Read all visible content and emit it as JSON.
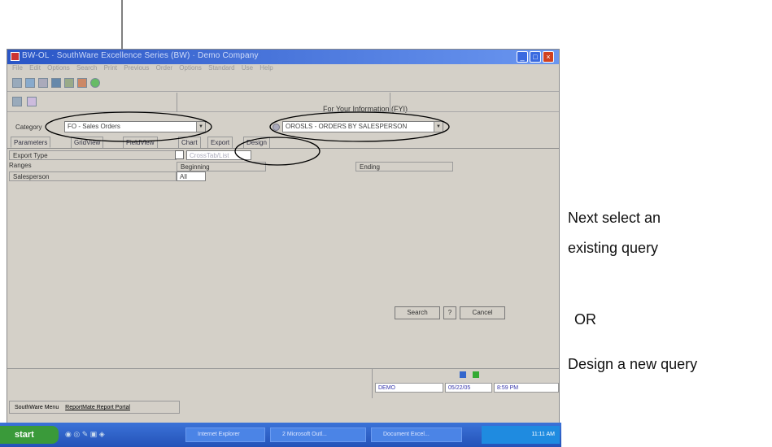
{
  "window": {
    "title": "BW-OL · SouthWare Excellence Series (BW) · Demo Company",
    "menu": [
      "File",
      "Edit",
      "Options",
      "Search",
      "Print",
      "Previous",
      "Order",
      "Options",
      "Standard",
      "Use",
      "Help"
    ],
    "fyi_title": "For Your Information (FYI)",
    "category_label": "Category",
    "category_value": "FO - Sales Orders",
    "query_value": "OROSLS  -  ORDERS BY SALESPERSON",
    "tabs": [
      "Parameters",
      "GridView",
      "FieldView",
      "Chart",
      "Export",
      "Design"
    ],
    "export_type_label": "Export Type",
    "export_option": "CrossTab/List",
    "ranges_label": "Ranges",
    "range_row_label": "Salesperson",
    "beginning_label": "Beginning",
    "beginning_value": "All",
    "ending_label": "Ending",
    "search_button": "Search",
    "cancel_button": "Cancel",
    "status": [
      "DEMO",
      "05/22/05",
      "8:59 PM"
    ],
    "bottom_tabs": [
      "SouthWare Menu",
      "ReportMate Report Portal"
    ]
  },
  "taskbar": {
    "start_label": "start",
    "tasks": [
      "Internet Explorer",
      "2 Microsoft Outl...",
      "Document Excel..."
    ],
    "clock": "11:11 AM"
  },
  "annotations": {
    "next_select": "Next select an",
    "existing_query": "existing query",
    "or": "OR",
    "design_new": "Design a new query"
  }
}
